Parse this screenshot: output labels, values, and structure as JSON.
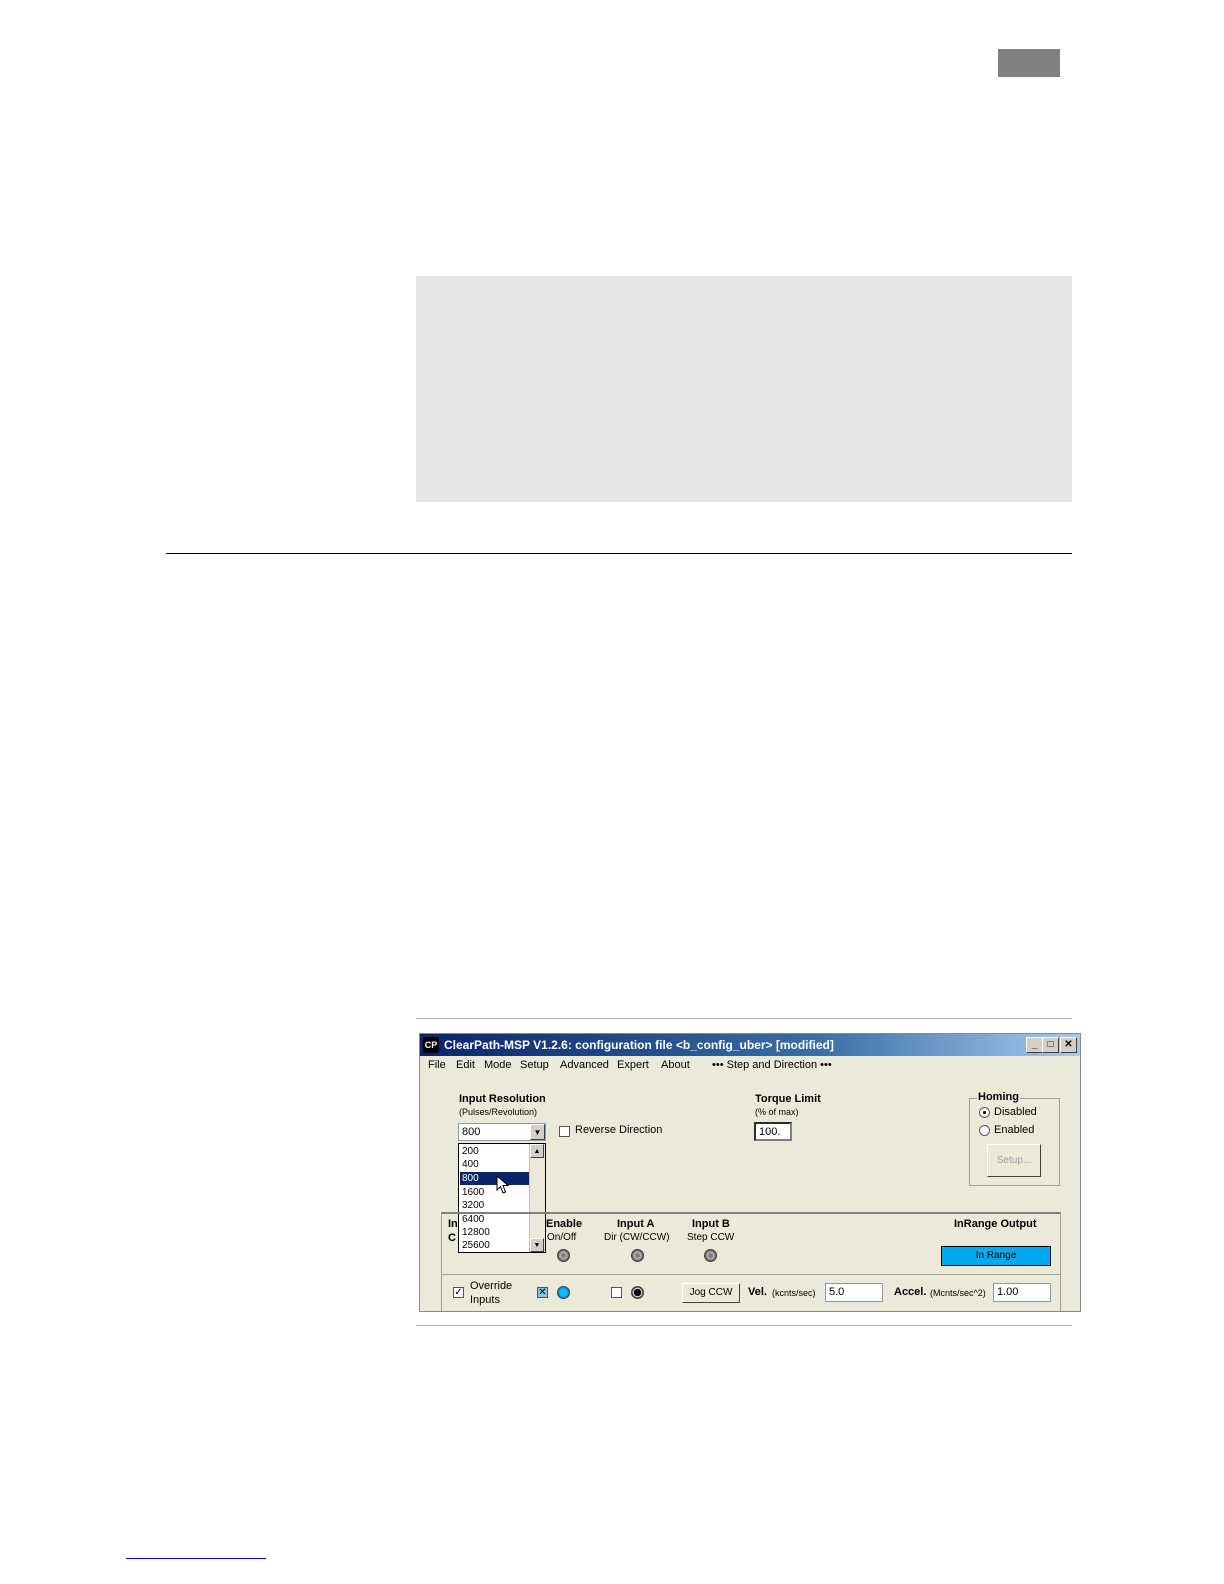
{
  "window": {
    "title": "ClearPath-MSP V1.2.6:  configuration file <b_config_uber> [modified]",
    "icon_label": "CP",
    "minimize": "_",
    "maximize": "□",
    "close": "✕"
  },
  "menu": {
    "items": [
      "File",
      "Edit",
      "Mode",
      "Setup",
      "Advanced",
      "Expert",
      "About"
    ],
    "mode_indicator": "••• Step and Direction •••"
  },
  "input_resolution": {
    "label": "Input Resolution",
    "sublabel": "(Pulses/Revolution)",
    "value": "800",
    "options": [
      "200",
      "400",
      "800",
      "1600",
      "3200",
      "6400",
      "12800",
      "25600"
    ],
    "selected": "800"
  },
  "reverse_direction": {
    "label": "Reverse Direction",
    "checked": false
  },
  "torque_limit": {
    "label": "Torque Limit",
    "sublabel": "(% of max)",
    "value": "100."
  },
  "homing": {
    "label": "Homing",
    "disabled_label": "Disabled",
    "enabled_label": "Enabled",
    "selected": "Disabled",
    "setup_button": "Setup..."
  },
  "inputs_panel": {
    "label_fragment_1": "In",
    "label_fragment_2": "C",
    "enable": {
      "label": "Enable",
      "sublabel": "On/Off"
    },
    "input_a": {
      "label": "Input A",
      "sublabel": "Dir (CW/CCW)"
    },
    "input_b": {
      "label": "Input B",
      "sublabel": "Step CCW"
    },
    "inrange_output": {
      "label": "InRange Output",
      "status": "In Range",
      "color": "#00aaee"
    }
  },
  "override": {
    "label_line1": "Override",
    "label_line2": "Inputs",
    "checked": true
  },
  "enable_override_check": "✕",
  "checkmark": "✓",
  "jog": {
    "button": "Jog CCW",
    "vel_label": "Vel.",
    "vel_unit": "(kcnts/sec)",
    "vel_value": "5.0",
    "accel_label": "Accel.",
    "accel_unit": "(Mcnts/sec^2)",
    "accel_value": "1.00"
  }
}
